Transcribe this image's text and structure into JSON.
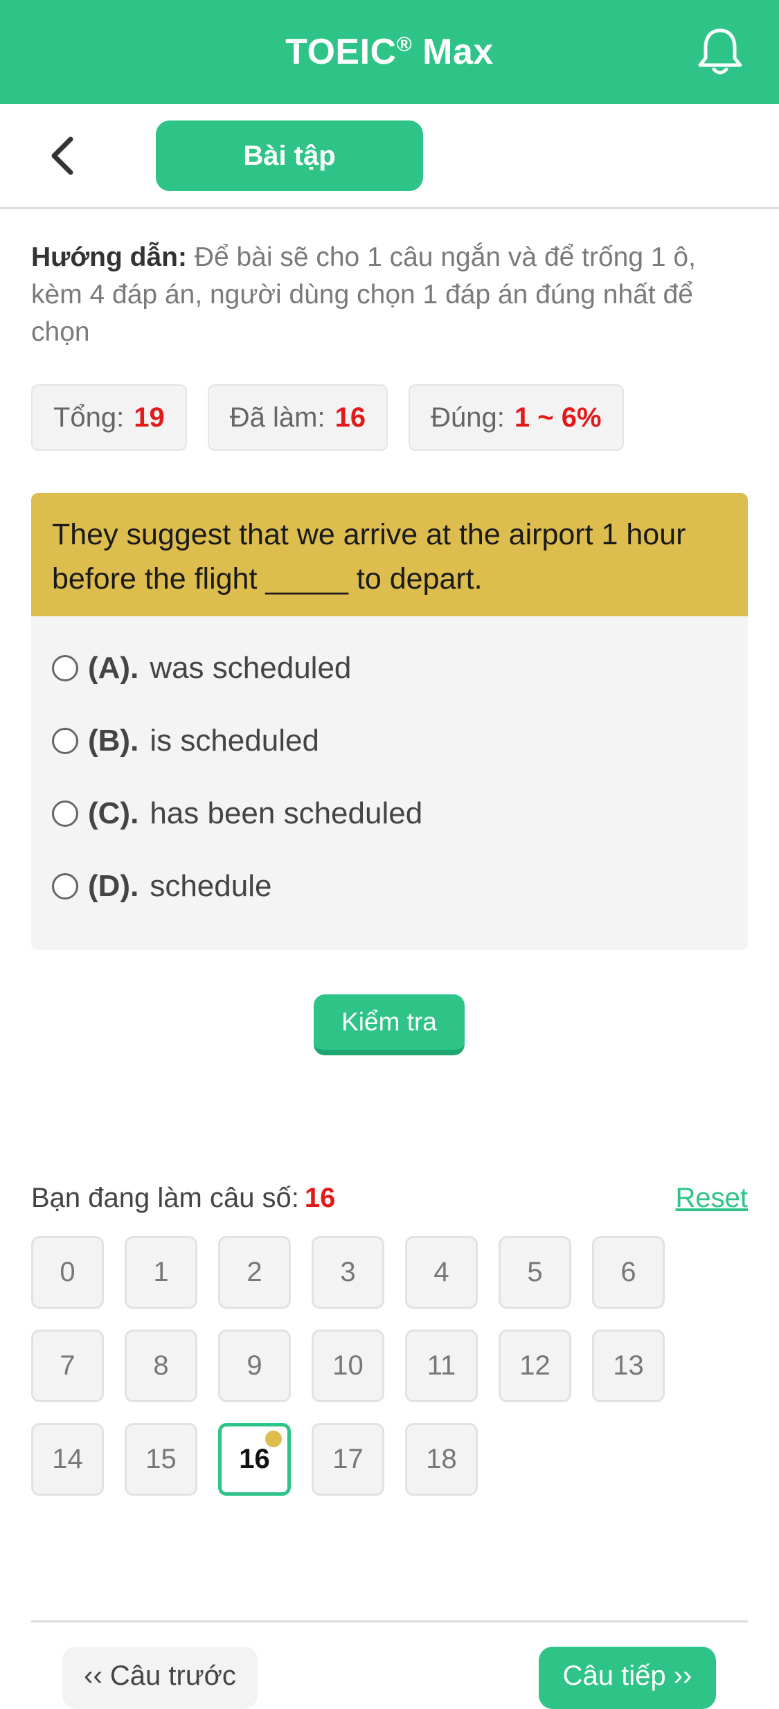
{
  "app": {
    "title": "TOEIC",
    "title_mark": "®",
    "title_suffix": " Max"
  },
  "subbar": {
    "tab_label": "Bài tập"
  },
  "instructions": {
    "label": "Hướng dẫn:",
    "text": " Để bài sẽ cho 1 câu ngắn và để trống 1 ô, kèm 4 đáp án, người dùng chọn 1 đáp án đúng nhất để chọn"
  },
  "stats": {
    "total_label": "Tổng:",
    "total_value": "19",
    "done_label": "Đã làm:",
    "done_value": "16",
    "correct_label": "Đúng:",
    "correct_value": "1 ~ 6%"
  },
  "question": {
    "text": "They suggest that we arrive at the airport 1 hour before the flight _____ to depart.",
    "options": [
      {
        "letter": "(A).",
        "text": "was scheduled"
      },
      {
        "letter": "(B).",
        "text": "is scheduled"
      },
      {
        "letter": "(C).",
        "text": "has been scheduled"
      },
      {
        "letter": "(D).",
        "text": "schedule"
      }
    ]
  },
  "check_button": "Kiểm tra",
  "progress": {
    "label": "Bạn đang làm câu số:",
    "current": "16",
    "reset": "Reset"
  },
  "grid": [
    "0",
    "1",
    "2",
    "3",
    "4",
    "5",
    "6",
    "7",
    "8",
    "9",
    "10",
    "11",
    "12",
    "13",
    "14",
    "15",
    "16",
    "17",
    "18"
  ],
  "nav": {
    "prev": "‹‹ Câu trước",
    "next": "Câu tiếp ››"
  },
  "colors": {
    "primary": "#2ec487",
    "question_bg": "#dcbd4e",
    "highlight_red": "#e21a1a"
  }
}
